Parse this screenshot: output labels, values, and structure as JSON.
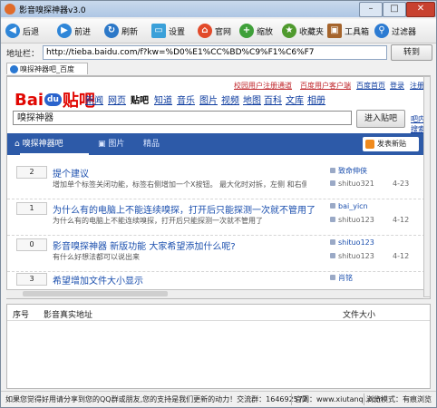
{
  "window": {
    "title": "影音嗅探神器v3.0"
  },
  "toolbar": [
    {
      "label": "后退",
      "icon": "back-icon",
      "color": "#2f86d8",
      "glyph": "◀"
    },
    {
      "label": "前进",
      "icon": "forward-icon",
      "color": "#2f86d8",
      "glyph": "▶"
    },
    {
      "label": "刷新",
      "icon": "refresh-icon",
      "color": "#2c78c8",
      "glyph": "↻"
    },
    {
      "label": "设置",
      "icon": "settings-icon",
      "color": "#3aa0d9",
      "glyph": "▭"
    },
    {
      "label": "官网",
      "icon": "home-icon",
      "color": "#e24a2a",
      "glyph": "⌂"
    },
    {
      "label": "缩放",
      "icon": "zoom-icon",
      "color": "#3fa03a",
      "glyph": "+"
    },
    {
      "label": "收藏夹",
      "icon": "favorites-star-icon",
      "color": "#4f9a2e",
      "glyph": "★"
    },
    {
      "label": "工具箱",
      "icon": "toolbox-icon",
      "color": "#a5642c",
      "glyph": "▣"
    },
    {
      "label": "过滤器",
      "icon": "filter-icon",
      "color": "#2c7bd2",
      "glyph": "⚲"
    }
  ],
  "address": {
    "label": "地址栏：",
    "url": "http://tieba.baidu.com/f?kw=%D0%E1%CC%BD%C9%F1%C6%F7",
    "go": "转到"
  },
  "browser_tab": {
    "label": "嗅探神器吧_百度"
  },
  "page": {
    "toplinks": [
      "校园用户注册通道",
      "百度用户客户端",
      "百度首页",
      "登录",
      "注册"
    ],
    "logo": {
      "bai": "Bai",
      "paw": "du",
      "tieba": "贴吧"
    },
    "nav": [
      "新闻",
      "网页",
      "贴吧",
      "知道",
      "音乐",
      "图片",
      "视频",
      "地图",
      "百科",
      "文库",
      "相册"
    ],
    "search_value": "嗅探神器",
    "enter_button": "进入贴吧",
    "bar_search": "吧内搜索",
    "forum_tabs": [
      "嗅探神器吧",
      "图片",
      "精品"
    ],
    "post_button": "发表新贴",
    "threads": [
      {
        "count": "2",
        "title": "提个建议",
        "abstract": "增加单个标签关闭功能，标签右侧增加一个X按钮。 最大化时对拆，左侧 和右侧 …",
        "author": "致命伸侠",
        "last": "shituo321",
        "date": "4-23"
      },
      {
        "count": "1",
        "title": "为什么有的电脑上不能连续嗅探，打开后只能探测一次就不管用了",
        "abstract": "为什么有的电脑上不能连续嗅探，打开后只能探测一次就不管用了",
        "author": "bai_yicn",
        "last": "shituo123",
        "date": "4-12"
      },
      {
        "count": "0",
        "title": "影音嗅探神器 新版功能 大家希望添加什么呢?",
        "abstract": "有什么好想法都可以说出来",
        "author": "shituo123",
        "last": "shituo123",
        "date": "4-12"
      },
      {
        "count": "3",
        "title": "希望增加文件大小显示",
        "abstract": "",
        "author": "肖铭",
        "last": "",
        "date": ""
      }
    ]
  },
  "list": {
    "columns": [
      "序号",
      "影音真实地址",
      "文件大小"
    ]
  },
  "status": {
    "message": "如果您觉得好用请分享到您的QQ群或朋友,您的支持是我们更新的动力！交流群：164692572",
    "site": "官网：www.xiutanqi.com",
    "mode": "浏览模式：有痕浏览"
  }
}
